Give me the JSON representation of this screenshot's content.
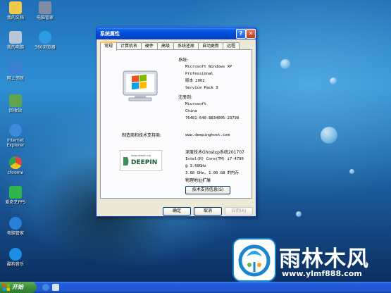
{
  "desktop": {
    "icons": [
      {
        "label": "我的文档",
        "name": "my-documents-icon",
        "color": "#f1c94a"
      },
      {
        "label": "电脑管家",
        "name": "pc-manager-icon",
        "color": "#7d8ea6"
      },
      {
        "label": "我的电脑",
        "name": "my-computer-icon",
        "color": "#b8c6d8"
      },
      {
        "label": "360浏览器",
        "name": "browser-360-icon",
        "color": "#2e9be6"
      },
      {
        "label": "网上邻居",
        "name": "network-places-icon",
        "color": "#3a7fd0"
      },
      {
        "label": "回收站",
        "name": "recycle-bin-icon",
        "color": "#5fa34c"
      },
      {
        "label": "Internet Explorer",
        "name": "ie-icon",
        "color": "#3d8ad9"
      },
      {
        "label": "chrome",
        "name": "chrome-icon",
        "color": "#e0463b"
      },
      {
        "label": "爱奇艺PPS",
        "name": "iqiyi-icon",
        "color": "#2fb34b"
      },
      {
        "label": "电脑管家",
        "name": "pc-manager-2-icon",
        "color": "#2a7fd8"
      },
      {
        "label": "酷狗音乐",
        "name": "kugou-icon",
        "color": "#1c8ee6"
      }
    ]
  },
  "window": {
    "title": "系统属性",
    "tabs": [
      "常规",
      "计算机名",
      "硬件",
      "高级",
      "系统还原",
      "自动更新",
      "远程"
    ],
    "system_heading": "系统:",
    "system_lines": [
      "Microsoft Windows XP",
      "Professional",
      "版本 2002",
      "Service Pack 3"
    ],
    "registered_heading": "注册到:",
    "registered_lines": [
      "Microsoft",
      "China",
      "76481-640-8834005-23798"
    ],
    "oem_caption": "制造商和技术支持商:",
    "oem_url": "www.deepinghost.com",
    "oem_logo_text": "DEEPIN",
    "oem_logo_small": "www.deepin.org",
    "oem_lines": [
      "深度技术Ghostxp系统201707",
      "Intel(R) Core(TM) i7-4790",
      "@ 3.60GHz",
      "3.60 GHz, 1.00 GB 的内存",
      "物理地址扩展"
    ],
    "support_button": "技术支持信息(S)",
    "ok_button": "确定",
    "cancel_button": "取消",
    "apply_button": "应用(A)"
  },
  "taskbar": {
    "start_label": "开始"
  },
  "watermark": {
    "name": "雨林木风",
    "url": "www.ylmf888.com"
  },
  "colors": {
    "title_bar": "#0048d8",
    "window_bg": "#ece9d8",
    "start_green": "#3c8f3b",
    "taskbar_blue": "#245edb"
  }
}
